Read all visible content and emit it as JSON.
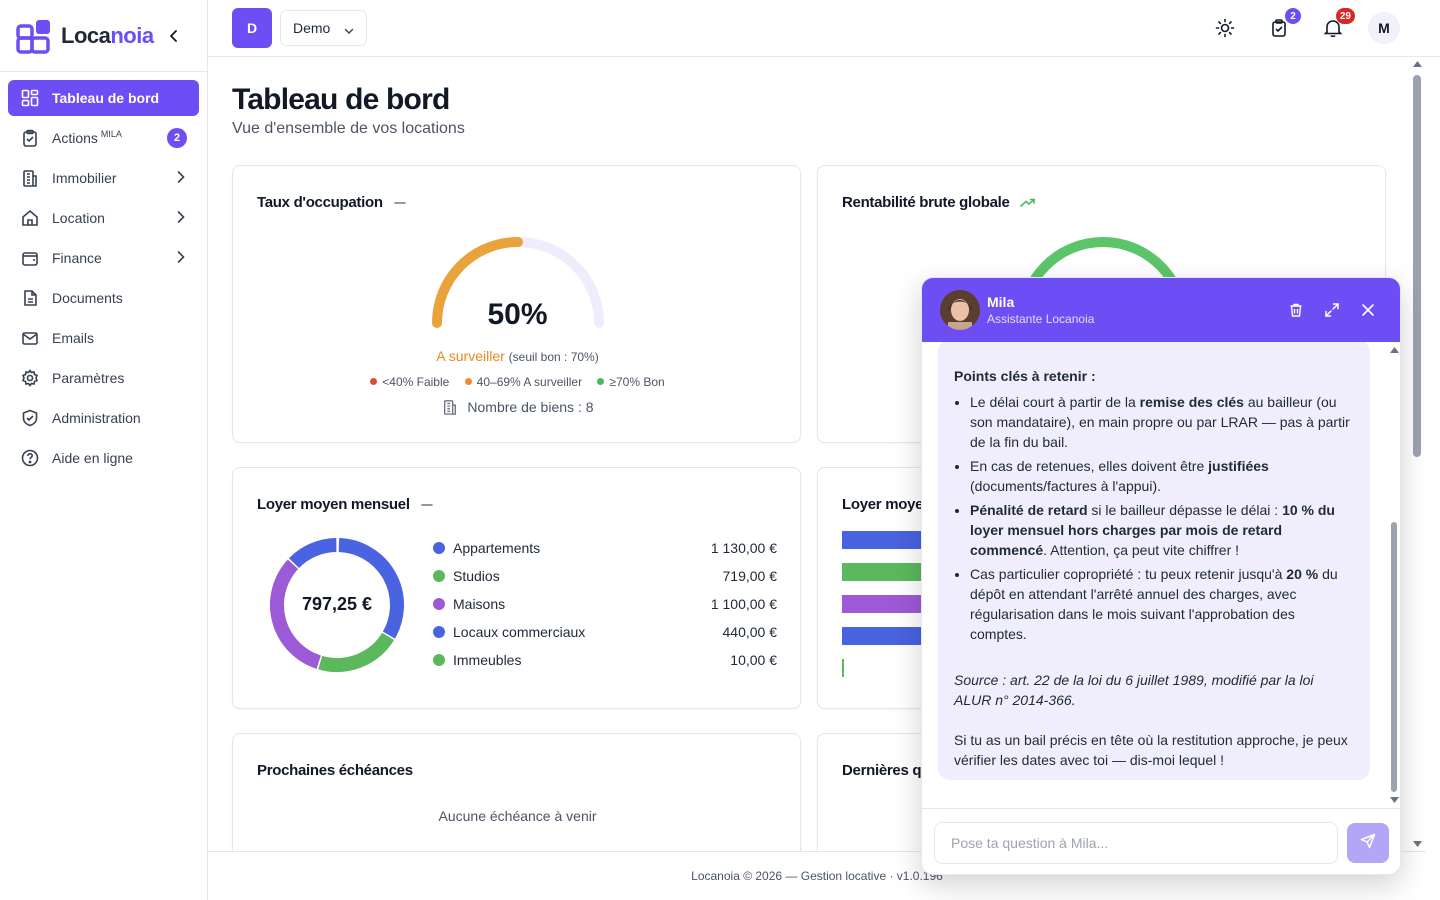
{
  "app": {
    "name_part1": "Loca",
    "name_part2": "noia"
  },
  "sidebar": {
    "items": [
      {
        "label": "Tableau de bord",
        "active": true
      },
      {
        "label": "Actions",
        "sup": "MILA",
        "badge": "2"
      },
      {
        "label": "Immobilier",
        "chevron": true
      },
      {
        "label": "Location",
        "chevron": true
      },
      {
        "label": "Finance",
        "chevron": true
      },
      {
        "label": "Documents"
      },
      {
        "label": "Emails"
      },
      {
        "label": "Paramètres"
      },
      {
        "label": "Administration"
      },
      {
        "label": "Aide en ligne"
      }
    ]
  },
  "header": {
    "workspace_initial": "D",
    "workspace_name": "Demo",
    "tasks_badge": "2",
    "notif_badge": "29",
    "user_initial": "M",
    "colors": {
      "tasks_badge": "#6d4ef5",
      "notif_badge": "#dc2626"
    }
  },
  "page": {
    "title": "Tableau de bord",
    "subtitle": "Vue d'ensemble de vos locations"
  },
  "occupancy": {
    "title": "Taux d'occupation",
    "value_text": "50%",
    "value": 50,
    "status": "A surveiller",
    "threshold": "(seuil bon : 70%)",
    "legend": [
      {
        "label": "<40% Faible",
        "color": "#dc4a3a"
      },
      {
        "label": "40–69% A surveiller",
        "color": "#f08a2e"
      },
      {
        "label": "≥70% Bon",
        "color": "#4cb85c"
      }
    ],
    "properties_count": "Nombre de biens : 8",
    "colors": {
      "arc": "#e8a33a",
      "track": "#efedfb",
      "status": "#e8891f"
    }
  },
  "yield": {
    "title": "Rentabilité brute globale",
    "color": "#5cc56a"
  },
  "rent": {
    "title": "Loyer moyen mensuel",
    "center": "797,25 €",
    "rows": [
      {
        "label": "Appartements",
        "value": "1 130,00 €",
        "color": "#4a63e0"
      },
      {
        "label": "Studios",
        "value": "719,00 €",
        "color": "#5cb85c"
      },
      {
        "label": "Maisons",
        "value": "1 100,00 €",
        "color": "#9d5ad6"
      },
      {
        "label": "Locaux commerciaux",
        "value": "440,00 €",
        "color": "#4a63e0"
      },
      {
        "label": "Immeubles",
        "value": "10,00 €",
        "color": "#5cb85c"
      }
    ]
  },
  "chart_data": {
    "type": "pie",
    "categories": [
      "Appartements",
      "Studios",
      "Maisons",
      "Locaux commerciaux",
      "Immeubles"
    ],
    "values": [
      1130,
      719,
      1100,
      440,
      10
    ],
    "title": "Loyer moyen mensuel"
  },
  "rent_by": {
    "title_visible": "Loyer moye"
  },
  "deadlines": {
    "title": "Prochaines échéances",
    "empty": "Aucune échéance à venir"
  },
  "latest": {
    "title_visible": "Dernières q"
  },
  "footer": {
    "text": "Locanoia © 2026 — Gestion locative · v1.0.196"
  },
  "chat": {
    "name": "Mila",
    "role": "Assistante Locanoia",
    "heading": "Points clés à retenir :",
    "bullets": [
      {
        "parts": [
          {
            "t": "Le délai court à partir de la "
          },
          {
            "t": "remise des clés",
            "b": true
          },
          {
            "t": " au bailleur (ou son mandataire), en main propre ou par LRAR — pas à partir de la fin du bail."
          }
        ]
      },
      {
        "parts": [
          {
            "t": "En cas de retenues, elles doivent être "
          },
          {
            "t": "justifiées",
            "b": true
          },
          {
            "t": " (documents/factures à l'appui)."
          }
        ]
      },
      {
        "parts": [
          {
            "t": "Pénalité de retard",
            "b": true
          },
          {
            "t": " si le bailleur dépasse le délai : "
          },
          {
            "t": "10 % du loyer mensuel hors charges par mois de retard commencé",
            "b": true
          },
          {
            "t": ". Attention, ça peut vite chiffrer !"
          }
        ]
      },
      {
        "parts": [
          {
            "t": "Cas particulier copropriété : tu peux retenir jusqu'à "
          },
          {
            "t": "20 %",
            "b": true
          },
          {
            "t": " du dépôt en attendant l'arrêté annuel des charges, avec régularisation dans le mois suivant l'approbation des comptes."
          }
        ]
      }
    ],
    "source": "Source : art. 22 de la loi du 6 juillet 1989, modifié par la loi ALUR n° 2014-366.",
    "closing": "Si tu as un bail précis en tête où la restitution approche, je peux vérifier les dates avec toi — dis-moi lequel !",
    "input_placeholder": "Pose ta question à Mila..."
  },
  "icons": {
    "logo": "locanoia-logo-icon",
    "collapse": "chevron-left-icon",
    "theme": "sun-icon",
    "tasks": "clipboard-check-icon",
    "notifications": "bell-icon",
    "send": "send-icon",
    "trash": "trash-icon",
    "expand": "expand-icon",
    "close": "close-icon"
  }
}
